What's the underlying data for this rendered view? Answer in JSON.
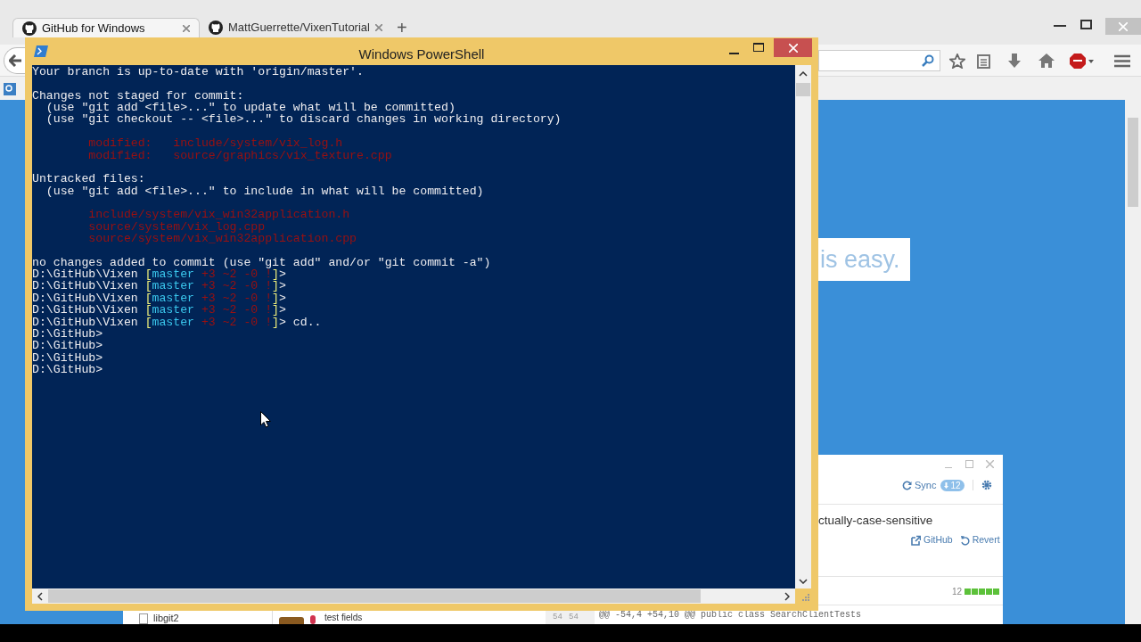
{
  "browser": {
    "tabs": [
      {
        "title": "GitHub for Windows",
        "selected": true
      },
      {
        "title": "MattGuerrette/VixenTutorial",
        "selected": false
      }
    ],
    "new_tab": "+"
  },
  "page": {
    "hero_text": "is easy."
  },
  "github_app": {
    "sync": "Sync",
    "sync_badge": "12",
    "branch": "ctually-case-sensitive",
    "links": [
      "GitHub",
      "Revert"
    ],
    "count": "12",
    "diff_header": "@@ -54,4 +54,10 @@ public class SearchClientTests",
    "old_line": "54",
    "new_line": "54",
    "sidebar_item": "libgit2",
    "commit": "test fields"
  },
  "powershell": {
    "title": "Windows PowerShell",
    "lines": [
      {
        "kind": "text",
        "segments": [
          {
            "text": "Your branch is up-to-date with 'origin/master'.",
            "kind": "plain"
          }
        ]
      },
      {
        "kind": "blank"
      },
      {
        "kind": "text",
        "segments": [
          {
            "text": "Changes not staged for commit:",
            "kind": "plain"
          }
        ]
      },
      {
        "kind": "text",
        "segments": [
          {
            "text": "  (use \"git add <file>...\" to update what will be committed)",
            "kind": "plain"
          }
        ]
      },
      {
        "kind": "text",
        "segments": [
          {
            "text": "  (use \"git checkout -- <file>...\" to discard changes in working directory)",
            "kind": "plain"
          }
        ]
      },
      {
        "kind": "blank"
      },
      {
        "kind": "text",
        "segments": [
          {
            "text": "        modified:   include/system/vix_log.h",
            "kind": "red"
          }
        ]
      },
      {
        "kind": "text",
        "segments": [
          {
            "text": "        modified:   source/graphics/vix_texture.cpp",
            "kind": "red"
          }
        ]
      },
      {
        "kind": "blank"
      },
      {
        "kind": "text",
        "segments": [
          {
            "text": "Untracked files:",
            "kind": "plain"
          }
        ]
      },
      {
        "kind": "text",
        "segments": [
          {
            "text": "  (use \"git add <file>...\" to include in what will be committed)",
            "kind": "plain"
          }
        ]
      },
      {
        "kind": "blank"
      },
      {
        "kind": "text",
        "segments": [
          {
            "text": "        include/system/vix_win32application.h",
            "kind": "red"
          }
        ]
      },
      {
        "kind": "text",
        "segments": [
          {
            "text": "        source/system/vix_log.cpp",
            "kind": "red"
          }
        ]
      },
      {
        "kind": "text",
        "segments": [
          {
            "text": "        source/system/vix_win32application.cpp",
            "kind": "red"
          }
        ]
      },
      {
        "kind": "blank"
      },
      {
        "kind": "text",
        "segments": [
          {
            "text": "no changes added to commit (use \"git add\" and/or \"git commit -a\")",
            "kind": "plain"
          }
        ]
      },
      {
        "kind": "text",
        "segments": [
          {
            "text": "D:\\GitHub\\Vixen ",
            "kind": "plain"
          },
          {
            "text": "[",
            "kind": "bracket"
          },
          {
            "text": "master",
            "kind": "branch"
          },
          {
            "text": " +3 ~2 -0 !",
            "kind": "red"
          },
          {
            "text": "]",
            "kind": "bracket"
          },
          {
            "text": ">",
            "kind": "plain"
          }
        ]
      },
      {
        "kind": "text",
        "segments": [
          {
            "text": "D:\\GitHub\\Vixen ",
            "kind": "plain"
          },
          {
            "text": "[",
            "kind": "bracket"
          },
          {
            "text": "master",
            "kind": "branch"
          },
          {
            "text": " +3 ~2 -0 !",
            "kind": "red"
          },
          {
            "text": "]",
            "kind": "bracket"
          },
          {
            "text": ">",
            "kind": "plain"
          }
        ]
      },
      {
        "kind": "text",
        "segments": [
          {
            "text": "D:\\GitHub\\Vixen ",
            "kind": "plain"
          },
          {
            "text": "[",
            "kind": "bracket"
          },
          {
            "text": "master",
            "kind": "branch"
          },
          {
            "text": " +3 ~2 -0 !",
            "kind": "red"
          },
          {
            "text": "]",
            "kind": "bracket"
          },
          {
            "text": ">",
            "kind": "plain"
          }
        ]
      },
      {
        "kind": "text",
        "segments": [
          {
            "text": "D:\\GitHub\\Vixen ",
            "kind": "plain"
          },
          {
            "text": "[",
            "kind": "bracket"
          },
          {
            "text": "master",
            "kind": "branch"
          },
          {
            "text": " +3 ~2 -0 !",
            "kind": "red"
          },
          {
            "text": "]",
            "kind": "bracket"
          },
          {
            "text": ">",
            "kind": "plain"
          }
        ]
      },
      {
        "kind": "text",
        "segments": [
          {
            "text": "D:\\GitHub\\Vixen ",
            "kind": "plain"
          },
          {
            "text": "[",
            "kind": "bracket"
          },
          {
            "text": "master",
            "kind": "branch"
          },
          {
            "text": " +3 ~2 -0 !",
            "kind": "red"
          },
          {
            "text": "]",
            "kind": "bracket"
          },
          {
            "text": "> cd..",
            "kind": "plain"
          }
        ]
      },
      {
        "kind": "text",
        "segments": [
          {
            "text": "D:\\GitHub>",
            "kind": "plain"
          }
        ]
      },
      {
        "kind": "text",
        "segments": [
          {
            "text": "D:\\GitHub>",
            "kind": "plain"
          }
        ]
      },
      {
        "kind": "text",
        "segments": [
          {
            "text": "D:\\GitHub>",
            "kind": "plain"
          }
        ]
      },
      {
        "kind": "text",
        "segments": [
          {
            "text": "D:\\GitHub>",
            "kind": "plain"
          }
        ]
      }
    ]
  }
}
